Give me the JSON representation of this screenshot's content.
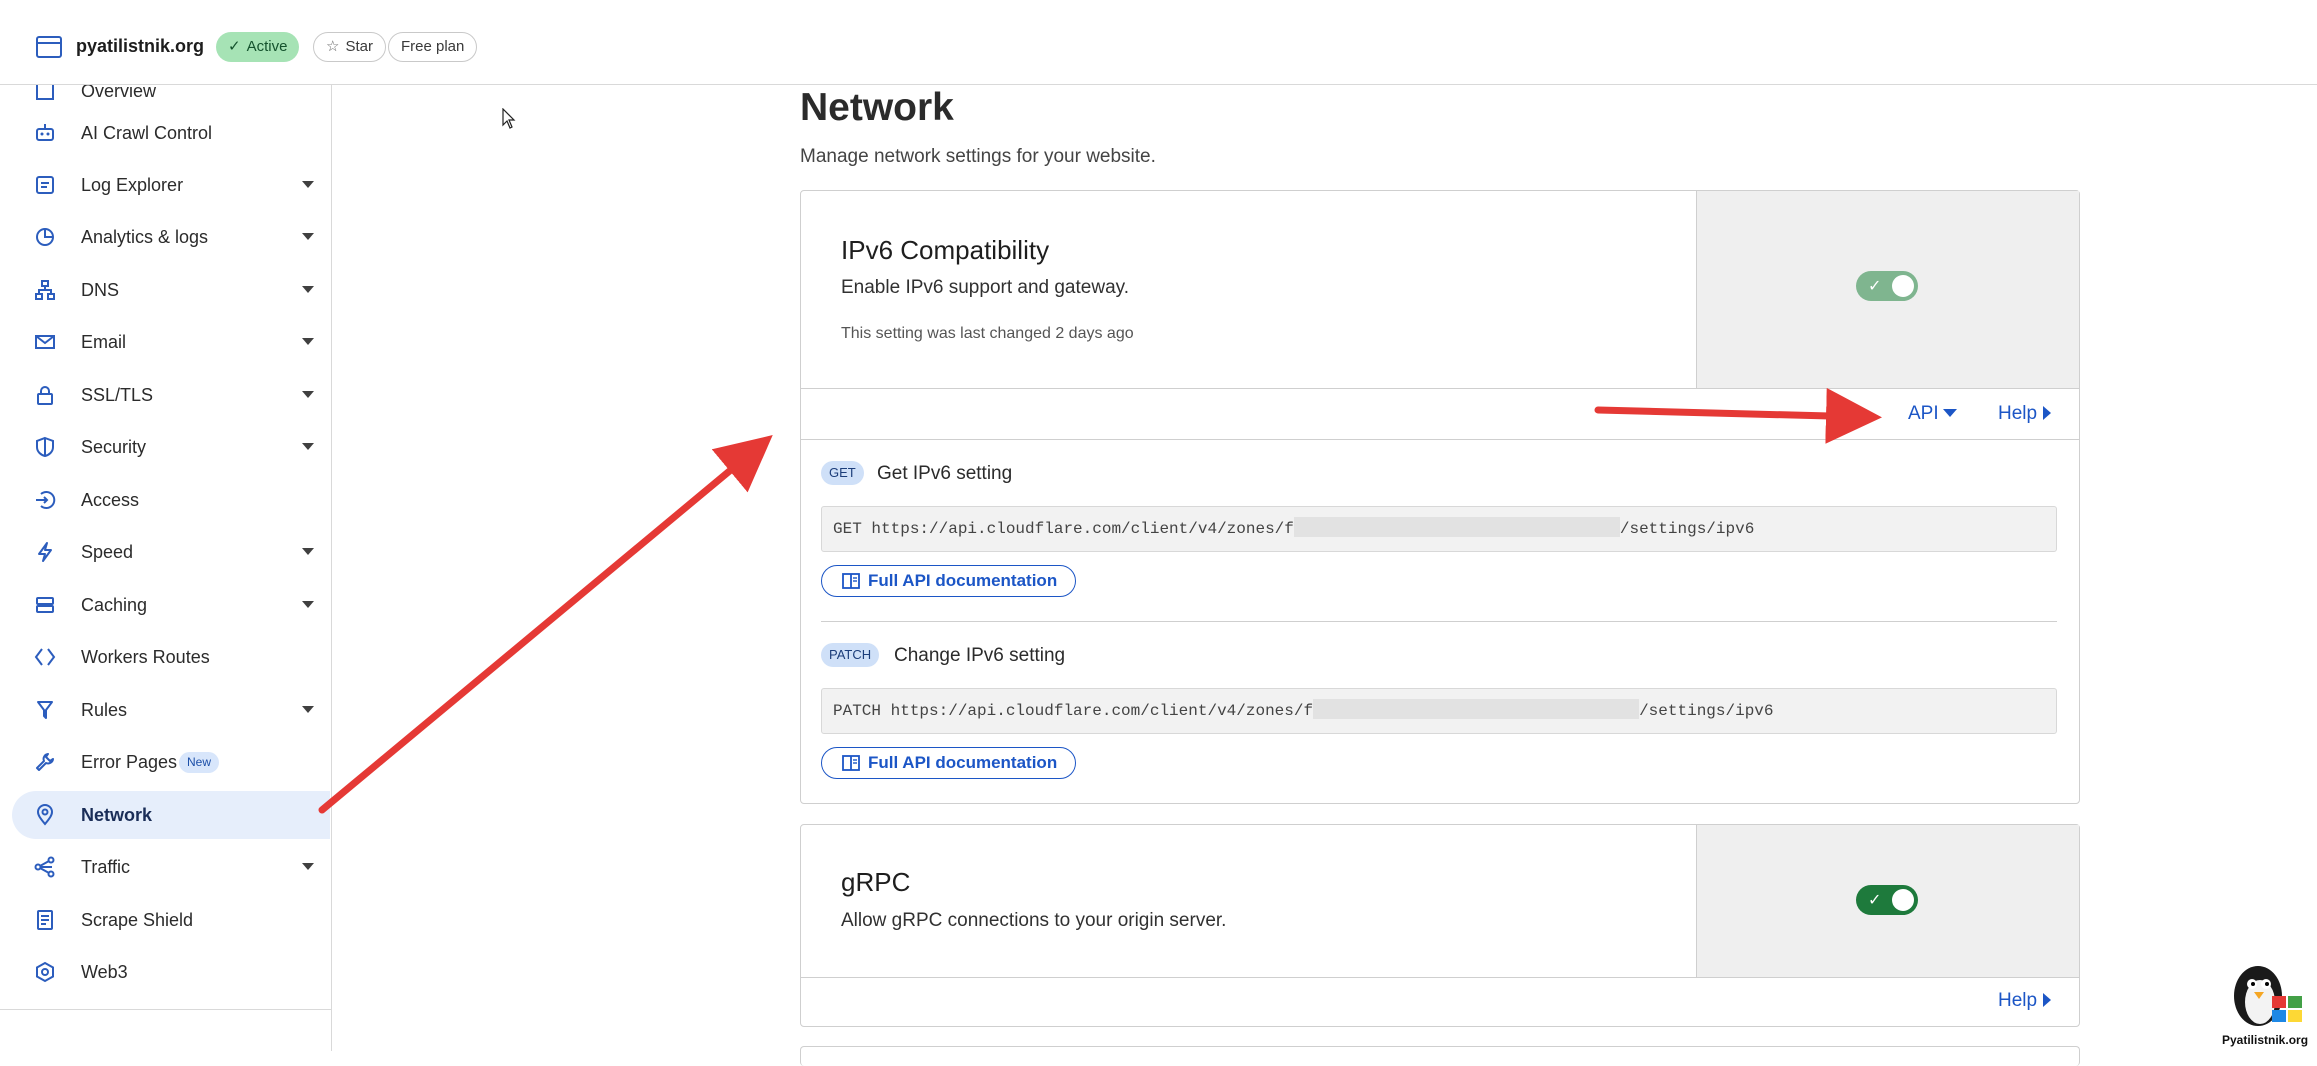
{
  "header": {
    "site_name": "pyatilistnik.org",
    "status_badge": "Active",
    "star_label": "Star",
    "plan_label": "Free plan"
  },
  "sidebar": {
    "items": [
      {
        "label": "Overview",
        "icon": "overview-icon",
        "has_caret": false
      },
      {
        "label": "AI Crawl Control",
        "icon": "robot-icon",
        "has_caret": false
      },
      {
        "label": "Log Explorer",
        "icon": "log-icon",
        "has_caret": true
      },
      {
        "label": "Analytics & logs",
        "icon": "pie-chart-icon",
        "has_caret": true
      },
      {
        "label": "DNS",
        "icon": "dns-network-icon",
        "has_caret": true
      },
      {
        "label": "Email",
        "icon": "email-icon",
        "has_caret": true
      },
      {
        "label": "SSL/TLS",
        "icon": "lock-icon",
        "has_caret": true
      },
      {
        "label": "Security",
        "icon": "shield-icon",
        "has_caret": true
      },
      {
        "label": "Access",
        "icon": "access-icon",
        "has_caret": false
      },
      {
        "label": "Speed",
        "icon": "lightning-icon",
        "has_caret": true
      },
      {
        "label": "Caching",
        "icon": "storage-icon",
        "has_caret": true
      },
      {
        "label": "Workers Routes",
        "icon": "workers-icon",
        "has_caret": false
      },
      {
        "label": "Rules",
        "icon": "rules-icon",
        "has_caret": true
      },
      {
        "label": "Error Pages",
        "icon": "wrench-icon",
        "has_caret": false,
        "badge": "New"
      },
      {
        "label": "Network",
        "icon": "location-pin-icon",
        "has_caret": false,
        "active": true
      },
      {
        "label": "Traffic",
        "icon": "traffic-icon",
        "has_caret": true
      },
      {
        "label": "Scrape Shield",
        "icon": "document-icon",
        "has_caret": false
      },
      {
        "label": "Web3",
        "icon": "web3-icon",
        "has_caret": false
      }
    ]
  },
  "main": {
    "title": "Network",
    "subtitle": "Manage network settings for your website.",
    "ipv6": {
      "title": "IPv6 Compatibility",
      "description": "Enable IPv6 support and gateway.",
      "last_changed": "This setting was last changed 2 days ago",
      "enabled": true,
      "api_link": "API",
      "help_link": "Help",
      "get": {
        "method": "GET",
        "title": "Get IPv6 setting",
        "url_prefix": "GET https://api.cloudflare.com/client/v4/zones/f",
        "url_suffix": "/settings/ipv6",
        "doc_button": "Full API documentation"
      },
      "patch": {
        "method": "PATCH",
        "title": "Change IPv6 setting",
        "url_prefix": "PATCH https://api.cloudflare.com/client/v4/zones/f",
        "url_suffix": "/settings/ipv6",
        "doc_button": "Full API documentation"
      }
    },
    "grpc": {
      "title": "gRPC",
      "description": "Allow gRPC connections to your origin server.",
      "enabled": true,
      "help_link": "Help"
    }
  },
  "watermark": {
    "text": "Pyatilistnik.org"
  },
  "colors": {
    "accent": "#1c56c6",
    "active_badge_bg": "#a6e3b5",
    "toggle_on": "#1e7a3c",
    "toggle_on_faded": "#7fb58f",
    "arrow": "#e53935"
  }
}
